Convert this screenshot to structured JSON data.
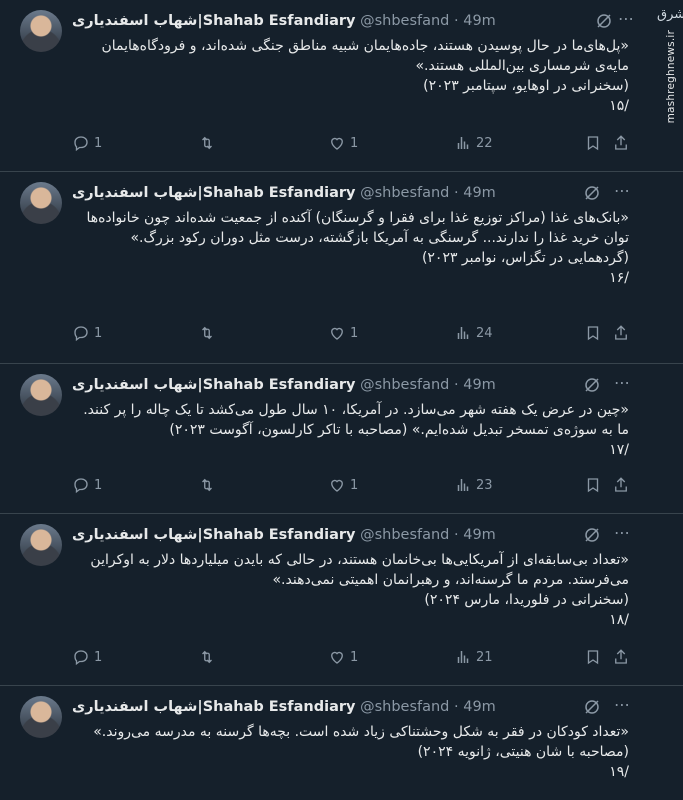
{
  "author": {
    "name_fa": "شهاب اسفندیاری",
    "separator": "|",
    "name_en": "Shahab Esfandiary",
    "handle": "@shbesfand",
    "dot": "·",
    "time": "49m"
  },
  "watermark": {
    "logo": "مشرق",
    "site": "mashreghnews.ir"
  },
  "icons": {
    "muted": "muted-icon",
    "more": "more-icon",
    "reply": "reply-icon",
    "retweet": "retweet-icon",
    "like": "like-icon",
    "views": "views-icon",
    "bookmark": "bookmark-icon",
    "share": "share-icon"
  },
  "tweets": [
    {
      "lines": [
        "«پل‌های‌ما در حال پوسیدن هستند، جاده‌هایمان شبیه مناطق جنگی شده‌اند، و فرودگاه‌هایمان مایه‌ی شرمساری بین‌المللی هستند.»",
        "(سخنرانی در اوهایو، سپتامبر ۲۰۲۳)",
        "/۱۵"
      ],
      "replies": "1",
      "retweets": "",
      "likes": "1",
      "views": "22"
    },
    {
      "lines": [
        "«بانک‌های غذا (مراکز توزیع غذا برای فقرا و گرسنگان) آکنده از جمعیت شده‌اند چون خانواده‌ها توان خرید غذا را ندارند... گرسنگی به آمریکا بازگشته، درست مثل دوران رکود بزرگ.»",
        "(گردهمایی در تگزاس، نوامبر ۲۰۲۳)",
        "/۱۶"
      ],
      "replies": "1",
      "retweets": "",
      "likes": "1",
      "views": "24"
    },
    {
      "lines": [
        "«چین در عرض یک هفته شهر می‌سازد. در آمریکا، ۱۰ سال طول می‌کشد تا یک چاله را پر کنند. ما به سوژه‌ی تمسخر تبدیل شده‌ایم.» (مصاحبه با تاکر کارلسون، آگوست ۲۰۲۳)",
        "/۱۷"
      ],
      "replies": "1",
      "retweets": "",
      "likes": "1",
      "views": "23"
    },
    {
      "lines": [
        "«تعداد بی‌سابقه‌ای از آمریکایی‌ها بی‌خانمان هستند، در حالی که بایدن میلیاردها دلار به اوکراین می‌فرستد. مردم ما گرسنه‌اند، و رهبرانمان اهمیتی نمی‌دهند.»",
        "(سخنرانی در فلوریدا، مارس ۲۰۲۴)",
        "/۱۸"
      ],
      "replies": "1",
      "retweets": "",
      "likes": "1",
      "views": "21"
    },
    {
      "lines": [
        "«تعداد کودکان در فقر به شکل وحشتناکی زیاد شده است. بچه‌ها گرسنه به مدرسه می‌روند.»",
        "(مصاحبه با شان هنیتی، ژانویه ۲۰۲۴)",
        "/۱۹"
      ],
      "replies": "",
      "retweets": "",
      "likes": "",
      "views": ""
    }
  ]
}
